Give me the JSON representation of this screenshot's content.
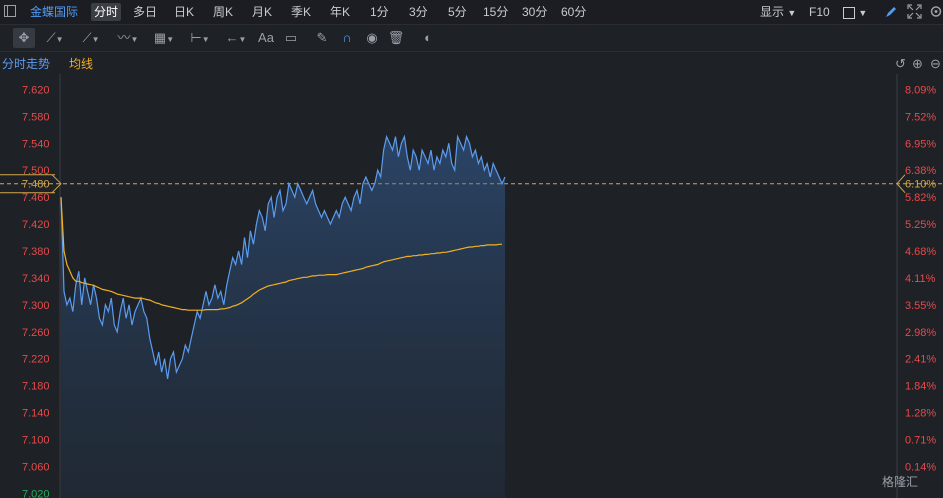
{
  "header": {
    "stock_name": "金蝶国际",
    "periods": [
      {
        "label": "分时",
        "active": true
      },
      {
        "label": "多日",
        "active": false
      },
      {
        "label": "日K",
        "active": false
      },
      {
        "label": "周K",
        "active": false
      },
      {
        "label": "月K",
        "active": false
      },
      {
        "label": "季K",
        "active": false
      },
      {
        "label": "年K",
        "active": false
      },
      {
        "label": "1分",
        "active": false
      },
      {
        "label": "3分",
        "active": false
      },
      {
        "label": "5分",
        "active": false
      },
      {
        "label": "15分",
        "active": false
      },
      {
        "label": "30分",
        "active": false
      },
      {
        "label": "60分",
        "active": false
      }
    ],
    "display_label": "显示",
    "f10_label": "F10"
  },
  "toolbar": {
    "icons": [
      "crosshair-icon",
      "line-icon",
      "channel-icon",
      "wave-icon",
      "fib-icon",
      "range-icon",
      "arrow-icon",
      "text-icon",
      "comment-icon",
      "eraser-icon",
      "magnet-icon",
      "eye-icon",
      "trash-icon",
      "toggle-icon"
    ],
    "text_tool_label": "Aa"
  },
  "legend": {
    "price_label": "分时走势",
    "avg_label": "均线"
  },
  "colors": {
    "background": "#1e2126",
    "price_line": "#5b9cf0",
    "avg_line": "#f0b020",
    "axis_up": "#e84a4a",
    "axis_down": "#25b05a",
    "ref_line": "#d4a84a",
    "accent": "#4f9cf5"
  },
  "chart_data": {
    "type": "line",
    "yticks_left": [
      "7.620",
      "7.580",
      "7.540",
      "7.500",
      "7.460",
      "7.420",
      "7.380",
      "7.340",
      "7.300",
      "7.260",
      "7.220",
      "7.180",
      "7.140",
      "7.100",
      "7.060",
      "7.020"
    ],
    "yticks_right": [
      "8.09%",
      "7.52%",
      "6.95%",
      "6.38%",
      "5.82%",
      "5.25%",
      "4.68%",
      "4.11%",
      "3.55%",
      "2.98%",
      "2.41%",
      "1.84%",
      "1.28%",
      "0.71%",
      "0.14%"
    ],
    "ylim": [
      7.013,
      7.643
    ],
    "ref_price": "7.480",
    "ref_pct": "6.10%",
    "x_count": 150,
    "price_series": [
      7.46,
      7.32,
      7.3,
      7.31,
      7.29,
      7.33,
      7.35,
      7.3,
      7.34,
      7.32,
      7.3,
      7.33,
      7.31,
      7.28,
      7.27,
      7.3,
      7.29,
      7.31,
      7.27,
      7.26,
      7.29,
      7.31,
      7.28,
      7.3,
      7.27,
      7.29,
      7.3,
      7.31,
      7.29,
      7.28,
      7.25,
      7.23,
      7.21,
      7.23,
      7.2,
      7.22,
      7.19,
      7.22,
      7.23,
      7.2,
      7.21,
      7.22,
      7.24,
      7.23,
      7.25,
      7.27,
      7.29,
      7.28,
      7.3,
      7.32,
      7.3,
      7.31,
      7.33,
      7.31,
      7.32,
      7.3,
      7.33,
      7.35,
      7.37,
      7.36,
      7.38,
      7.36,
      7.4,
      7.37,
      7.41,
      7.39,
      7.42,
      7.44,
      7.43,
      7.41,
      7.45,
      7.46,
      7.43,
      7.46,
      7.47,
      7.44,
      7.45,
      7.48,
      7.47,
      7.46,
      7.48,
      7.47,
      7.46,
      7.45,
      7.46,
      7.47,
      7.45,
      7.44,
      7.43,
      7.44,
      7.43,
      7.42,
      7.43,
      7.44,
      7.43,
      7.45,
      7.46,
      7.45,
      7.44,
      7.46,
      7.47,
      7.45,
      7.48,
      7.49,
      7.48,
      7.47,
      7.48,
      7.5,
      7.49,
      7.53,
      7.55,
      7.54,
      7.53,
      7.55,
      7.52,
      7.54,
      7.55,
      7.52,
      7.5,
      7.53,
      7.52,
      7.5,
      7.53,
      7.52,
      7.51,
      7.53,
      7.5,
      7.52,
      7.51,
      7.53,
      7.52,
      7.54,
      7.51,
      7.5,
      7.55,
      7.54,
      7.53,
      7.55,
      7.54,
      7.52,
      7.53,
      7.51,
      7.52,
      7.5,
      7.51,
      7.49,
      7.51,
      7.5,
      7.49,
      7.48,
      7.49
    ],
    "avg_series": [
      7.46,
      7.38,
      7.36,
      7.35,
      7.34,
      7.335,
      7.335,
      7.333,
      7.332,
      7.331,
      7.33,
      7.329,
      7.327,
      7.325,
      7.323,
      7.322,
      7.321,
      7.32,
      7.318,
      7.316,
      7.315,
      7.314,
      7.313,
      7.312,
      7.311,
      7.31,
      7.31,
      7.31,
      7.309,
      7.308,
      7.307,
      7.305,
      7.303,
      7.302,
      7.3,
      7.299,
      7.298,
      7.297,
      7.296,
      7.295,
      7.294,
      7.293,
      7.293,
      7.292,
      7.292,
      7.292,
      7.292,
      7.292,
      7.292,
      7.293,
      7.293,
      7.293,
      7.293,
      7.293,
      7.294,
      7.294,
      7.295,
      7.296,
      7.298,
      7.299,
      7.301,
      7.303,
      7.306,
      7.309,
      7.312,
      7.316,
      7.319,
      7.322,
      7.324,
      7.326,
      7.328,
      7.329,
      7.33,
      7.331,
      7.332,
      7.333,
      7.334,
      7.336,
      7.337,
      7.338,
      7.339,
      7.34,
      7.341,
      7.341,
      7.342,
      7.343,
      7.343,
      7.344,
      7.344,
      7.344,
      7.345,
      7.345,
      7.345,
      7.345,
      7.346,
      7.347,
      7.348,
      7.349,
      7.35,
      7.351,
      7.352,
      7.353,
      7.354,
      7.356,
      7.357,
      7.358,
      7.359,
      7.36,
      7.362,
      7.364,
      7.365,
      7.366,
      7.367,
      7.368,
      7.369,
      7.37,
      7.371,
      7.372,
      7.372,
      7.373,
      7.373,
      7.374,
      7.374,
      7.375,
      7.375,
      7.376,
      7.376,
      7.377,
      7.377,
      7.378,
      7.378,
      7.379,
      7.38,
      7.381,
      7.382,
      7.383,
      7.384,
      7.385,
      7.386,
      7.386,
      7.387,
      7.387,
      7.388,
      7.388,
      7.389,
      7.389,
      7.389,
      7.389,
      7.39,
      7.39
    ]
  },
  "watermark": "格隆汇"
}
